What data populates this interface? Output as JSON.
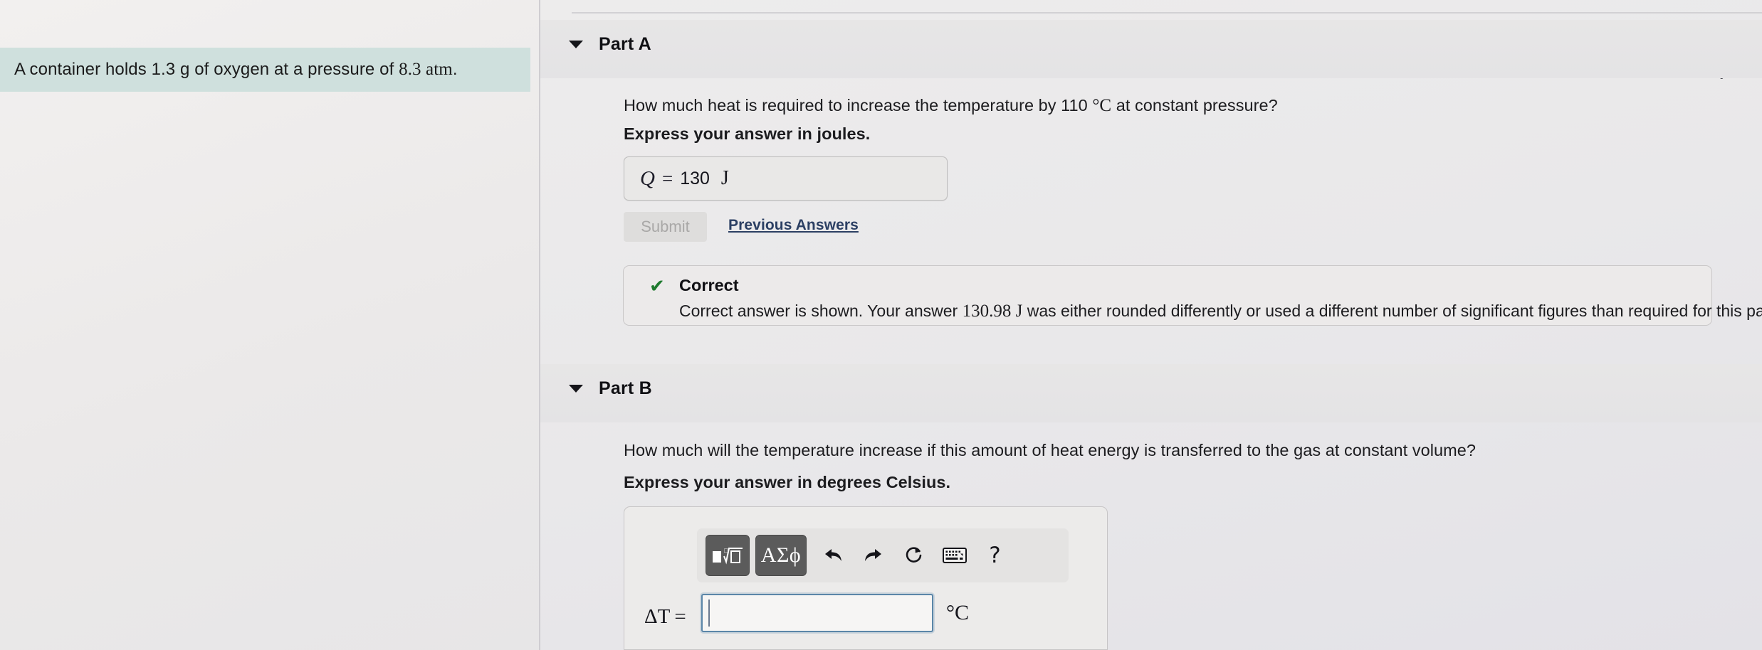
{
  "left_pane": {
    "question_text_part1": "A container holds 1.3 g of oxygen at a pressure of ",
    "question_unit": "8.3 atm",
    "question_text_part2": "."
  },
  "right_pane": {
    "status_check_icon": "✔",
    "parts": [
      {
        "id": "part-a",
        "caret_icon": "caret-down-icon",
        "title": "Part A",
        "prompt_before": "How much heat is required to increase the temperature by 110 ",
        "prompt_symbol": "°C",
        "prompt_after": " at constant pressure?",
        "instruction": "Express your answer in joules.",
        "answer": {
          "variable": "Q",
          "equals": "=",
          "value": "130",
          "unit": "J"
        },
        "submit_label": "Submit",
        "previous_answers_label": "Previous Answers",
        "feedback": {
          "check_icon": "✔",
          "title": "Correct",
          "description_before": "Correct answer is shown. Your answer ",
          "description_value": "130.98 J",
          "description_after": " was either rounded differently or used a different number of significant figures than required for this part."
        }
      },
      {
        "id": "part-b",
        "caret_icon": "caret-down-icon",
        "title": "Part B",
        "prompt": "How much will the temperature increase if this amount of heat energy is transferred to the gas at constant volume?",
        "instruction": "Express your answer in degrees Celsius.",
        "toolbar": [
          {
            "name": "template-sqrt-button",
            "glyph": "■√□",
            "style": "dark"
          },
          {
            "name": "greek-symbols-button",
            "glyph": "ΑΣϕ",
            "style": "dark"
          },
          {
            "name": "undo-button",
            "glyph": "↩",
            "style": "plain"
          },
          {
            "name": "redo-button",
            "glyph": "↪",
            "style": "plain"
          },
          {
            "name": "reset-button",
            "glyph": "↻",
            "style": "plain"
          },
          {
            "name": "keyboard-button",
            "glyph": "⌨",
            "style": "plain"
          },
          {
            "name": "help-button",
            "glyph": "?",
            "style": "plain"
          }
        ],
        "answer": {
          "variable": "ΔT",
          "equals": "=",
          "value": "",
          "placeholder": "",
          "unit": "°C"
        }
      }
    ]
  },
  "colors": {
    "question_highlight": "#cfe0dd",
    "correct_green": "#1e7a2e",
    "link_blue": "#2b3f63",
    "focus_border": "#5b86a8",
    "toolbar_dark": "#5b5b5b"
  }
}
